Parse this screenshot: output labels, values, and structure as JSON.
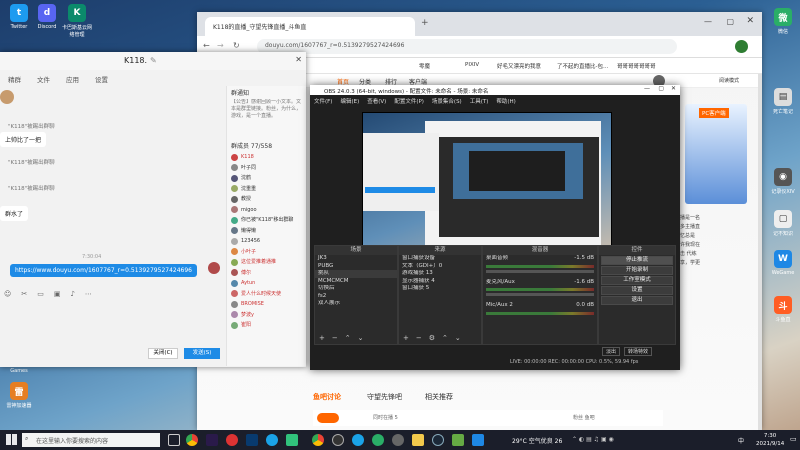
{
  "desktop": {
    "left_icons": [
      {
        "label": "Twitter",
        "icon": "twitter-icon",
        "color": "#1d9bf0"
      },
      {
        "label": "Discord",
        "icon": "discord-icon",
        "color": "#5865f2"
      },
      {
        "label": "卡巴斯基云网络管理",
        "icon": "kaspersky-icon",
        "color": "#0b8a6b"
      },
      {
        "label": "Games",
        "icon": "games-icon",
        "color": "#c0392b"
      },
      {
        "label": "雷神加速器",
        "icon": "leishen-icon",
        "color": "#e67e22"
      }
    ],
    "right_icons": [
      {
        "label": "微信",
        "icon": "wechat-icon",
        "color": "#2aae67"
      },
      {
        "label": "死亡笔记",
        "icon": "notebook-icon",
        "color": "#dddddd"
      },
      {
        "label": "记录仪XIV",
        "icon": "recorder-icon",
        "color": "#555555"
      },
      {
        "label": "记不知识",
        "icon": "note-icon",
        "color": "#eeeeee"
      },
      {
        "label": "WeGame",
        "icon": "wegame-icon",
        "color": "#1e88e5"
      },
      {
        "label": "斗鱼直",
        "icon": "douyu-icon",
        "color": "#ff5d23"
      }
    ]
  },
  "browser": {
    "tab_title": "K118的直播_守望先锋直播_斗鱼直",
    "url": "douyu.com/1607767_r=0.5139279527424696",
    "bookmarks": [
      "dy",
      "dbqb",
      "C",
      "零魔",
      "PIXIV",
      "好毛又漂亮的我意",
      "了不起的直播比-包…",
      "哥哥哥哥哥哥哥"
    ],
    "site_nav": [
      "首页",
      "分类",
      "排行",
      "客户端",
      "更多"
    ],
    "site_right": [
      "阅读模式",
      "PC客户端",
      "鱼吧讨论",
      "守望先锋吧",
      "相关推荐"
    ],
    "side_notes": [
      "主播是一名",
      "更多主播直",
      "回忆总是",
      "也许我现在",
      "点击 代练",
      "分享，学更"
    ],
    "stream_labels": [
      "同时在播 5",
      "粉丝 鱼吧"
    ]
  },
  "chat": {
    "title": "K118.",
    "tabs": [
      "精群",
      "文件",
      "应用",
      "设置"
    ],
    "messages": [
      {
        "text": "",
        "side": "left"
      },
      {
        "text": "\"K118\"被踢出群聊",
        "side": "system"
      },
      {
        "text": "上帅比了一把",
        "side": "left"
      },
      {
        "text": "\"K118\"被踢出群聊",
        "side": "system"
      },
      {
        "text": "\"K118\"被踢出群聊",
        "side": "system"
      },
      {
        "text": "群水了",
        "side": "left"
      },
      {
        "text": "7:30:04",
        "side": "time"
      },
      {
        "text": "https://www.douyu.com/1607767_r=0.5139279527424696",
        "side": "right"
      }
    ],
    "notice_title": "群通知",
    "notice_text": "【公告】感谢回顾一小文本。文本是群里链接。粉丝，为什么，游戏，是一个直播。",
    "member_title": "群成员 77/558",
    "members": [
      "K118",
      "叶子同",
      "沈鹤",
      "沈重重",
      "教授",
      "migoo",
      "你已被\"K118\"移出群聊",
      "懒得懒",
      "123456",
      "小叶子",
      "这位爱推着通推",
      "傅尔",
      "Aytun",
      "爱人什么时候天使",
      "BROMISE",
      "梦波y",
      "崔阳"
    ],
    "close_btn": "关闭(C)",
    "send_btn": "发送(S)"
  },
  "obs": {
    "title": "OBS 24.0.3 (64-bit, windows) - 配置文件: 未命名 - 场景: 未命名",
    "menu": [
      "文件(F)",
      "编辑(E)",
      "查看(V)",
      "配置文件(P)",
      "场景集合(S)",
      "工具(T)",
      "帮助(H)"
    ],
    "scenes_header": "场景",
    "scenes": [
      "JK3",
      "PUBG",
      "挑队",
      "MCMCMCM",
      "切换后",
      "fs2",
      "双人展示"
    ],
    "sources_header": "来源",
    "sources": [
      "窗口捕获设备",
      "文本（GDI+）0",
      "游戏捕获 13",
      "显示器捕获 4",
      "窗口捕获 5"
    ],
    "mixer_header": "混音器",
    "mixer": [
      {
        "name": "桌面音频",
        "db": "-1.5 dB"
      },
      {
        "name": "麦克风/Aux",
        "db": "-1.6 dB"
      },
      {
        "name": "Mic/Aux 2",
        "db": "0.0 dB"
      }
    ],
    "controls_header": "控件",
    "controls": [
      "停止推流",
      "开始录制",
      "工作室模式",
      "设置",
      "退出"
    ],
    "transitions": [
      "淡出",
      "转场特效"
    ],
    "status": "LIVE: 00:00:00   REC: 00:00:00   CPU: 0.5%, 59.94 fps"
  },
  "taskbar": {
    "search_placeholder": "在这里输入你要搜索的内容",
    "weather": "29°C 空气优良 26",
    "time": "7:30",
    "date": "2021/9/14",
    "lang": "中"
  }
}
